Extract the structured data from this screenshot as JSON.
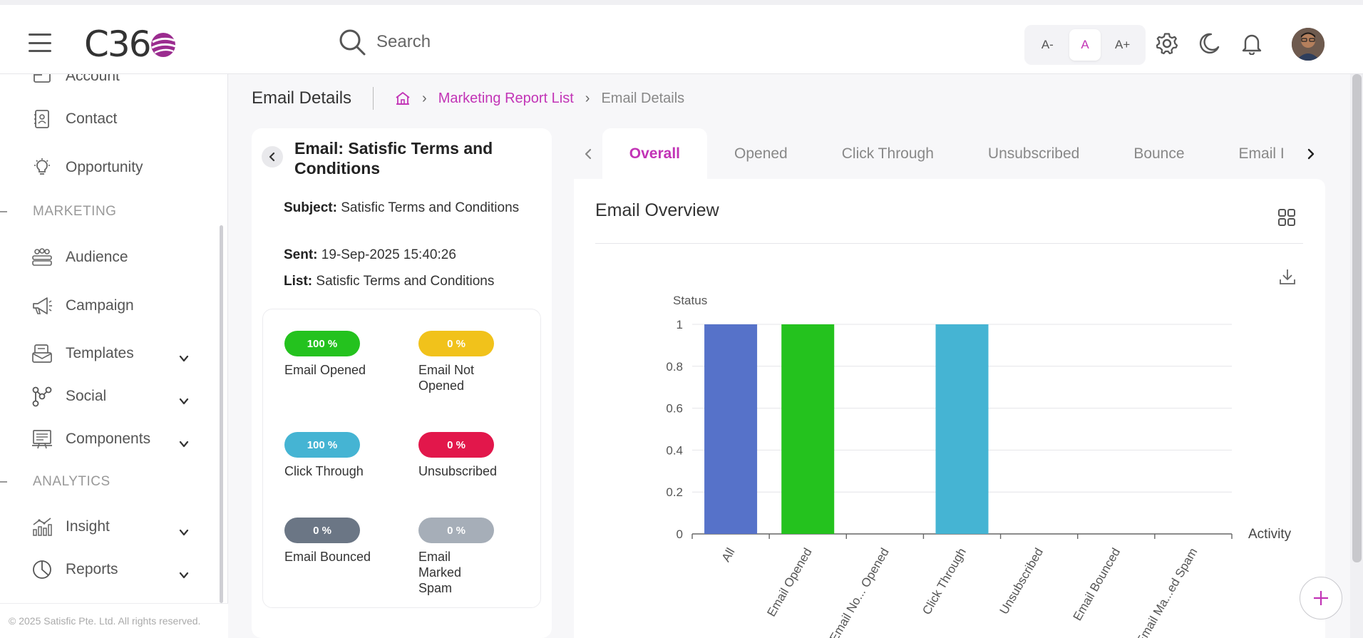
{
  "header": {
    "logo_text": "C36",
    "search_placeholder": "Search",
    "font_small": "A-",
    "font_normal": "A",
    "font_large": "A+"
  },
  "sidebar": {
    "items_top": [
      {
        "label": "Account",
        "icon": "account-icon"
      },
      {
        "label": "Contact",
        "icon": "contact-icon"
      },
      {
        "label": "Opportunity",
        "icon": "lightbulb-icon"
      }
    ],
    "section_marketing": "MARKETING",
    "items_marketing": [
      {
        "label": "Audience",
        "icon": "people-icon"
      },
      {
        "label": "Campaign",
        "icon": "megaphone-icon"
      },
      {
        "label": "Templates",
        "icon": "template-icon"
      },
      {
        "label": "Social",
        "icon": "social-icon"
      },
      {
        "label": "Components",
        "icon": "components-icon"
      }
    ],
    "section_analytics": "ANALYTICS",
    "items_analytics": [
      {
        "label": "Insight",
        "icon": "insight-icon"
      },
      {
        "label": "Reports",
        "icon": "pie-icon"
      }
    ],
    "footer": "© 2025 Satisfic Pte. Ltd. All rights reserved."
  },
  "page": {
    "title": "Email Details",
    "breadcrumb": {
      "link": "Marketing Report List",
      "current": "Email Details"
    }
  },
  "email": {
    "title": "Email: Satisfic Terms and Conditions",
    "subject_label": "Subject:",
    "subject": "Satisfic Terms and Conditions",
    "sent_label": "Sent:",
    "sent": "19-Sep-2025 15:40:26",
    "list_label": "List:",
    "list": "Satisfic Terms and Conditions"
  },
  "stats": [
    {
      "pct": "100 %",
      "label": "Email Opened",
      "color": "#24c21e"
    },
    {
      "pct": "0 %",
      "label": "Email Not Opened",
      "color": "#f1c21b"
    },
    {
      "pct": "100 %",
      "label": "Click Through",
      "color": "#45b4d3"
    },
    {
      "pct": "0 %",
      "label": "Unsubscribed",
      "color": "#e2174b"
    },
    {
      "pct": "0 %",
      "label": "Email Bounced",
      "color": "#6b7685"
    },
    {
      "pct": "0 %",
      "label": "Email Marked Spam",
      "color": "#a6aeb8"
    }
  ],
  "tabs": [
    "Overall",
    "Opened",
    "Click Through",
    "Unsubscribed",
    "Bounce",
    "Email I"
  ],
  "panel": {
    "title": "Email Overview"
  },
  "chart_data": {
    "type": "bar",
    "categories": [
      "All",
      "Email Opened",
      "Email No... Opened",
      "Click Through",
      "Unsubscribed",
      "Email Bounced",
      "Email Ma...ed Spam"
    ],
    "values": [
      1,
      1,
      0,
      1,
      0,
      0,
      0
    ],
    "colors": [
      "#5672c9",
      "#24c21e",
      "#f1c21b",
      "#45b4d3",
      "#e2174b",
      "#6b7685",
      "#a6aeb8"
    ],
    "ylabel": "Status",
    "xlabel": "Activity",
    "yticks": [
      "0",
      "0.2",
      "0.4",
      "0.6",
      "0.8",
      "1"
    ],
    "ylim": [
      0,
      1
    ],
    "grid": true
  }
}
